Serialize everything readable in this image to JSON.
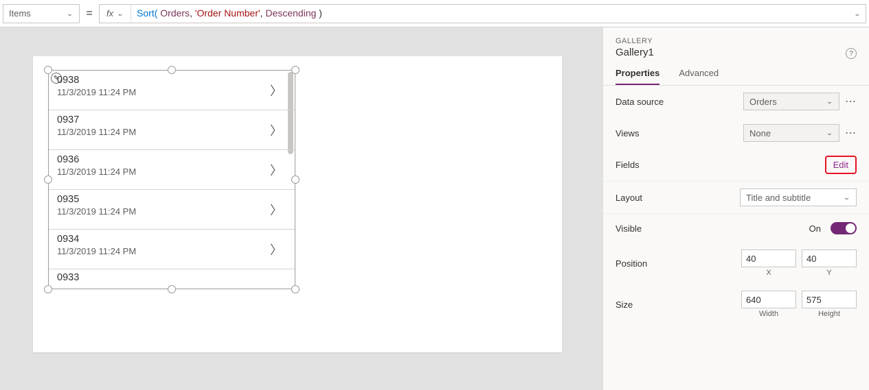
{
  "formula_bar": {
    "property": "Items",
    "equals": "=",
    "fx_label": "fx",
    "tokens": {
      "t1": "Sort( ",
      "t2": "Orders",
      "t3": ", ",
      "t4": "'Order Number'",
      "t5": ", ",
      "t6": "Descending",
      "t7": " )"
    }
  },
  "gallery": {
    "rows": [
      {
        "title": "0938",
        "subtitle": "11/3/2019 11:24 PM"
      },
      {
        "title": "0937",
        "subtitle": "11/3/2019 11:24 PM"
      },
      {
        "title": "0936",
        "subtitle": "11/3/2019 11:24 PM"
      },
      {
        "title": "0935",
        "subtitle": "11/3/2019 11:24 PM"
      },
      {
        "title": "0934",
        "subtitle": "11/3/2019 11:24 PM"
      },
      {
        "title": "0933",
        "subtitle": ""
      }
    ]
  },
  "panel": {
    "category": "GALLERY",
    "name": "Gallery1",
    "tabs": {
      "properties": "Properties",
      "advanced": "Advanced"
    },
    "datasource_label": "Data source",
    "datasource_value": "Orders",
    "views_label": "Views",
    "views_value": "None",
    "fields_label": "Fields",
    "fields_edit": "Edit",
    "layout_label": "Layout",
    "layout_value": "Title and subtitle",
    "visible_label": "Visible",
    "visible_on": "On",
    "position_label": "Position",
    "pos_x": "40",
    "pos_x_l": "X",
    "pos_y": "40",
    "pos_y_l": "Y",
    "size_label": "Size",
    "width": "640",
    "width_l": "Width",
    "height": "575",
    "height_l": "Height"
  },
  "glyph": {
    "chevron_down": "⌄",
    "chevron_right": "〉",
    "pencil": "✎",
    "question": "?",
    "ellipsis": "⋯"
  }
}
